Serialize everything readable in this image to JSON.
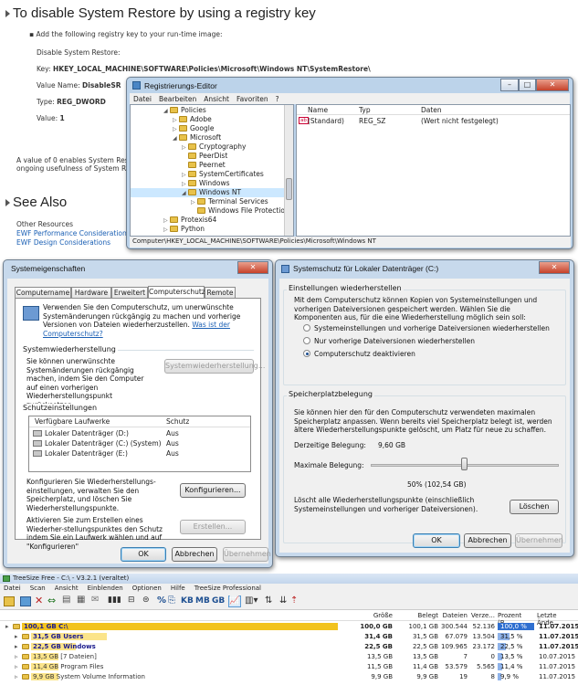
{
  "doc": {
    "heading": "To disable System Restore by using a registry key",
    "bullet": "Add the following registry key to your run-time image:",
    "disable_label": "Disable System Restore:",
    "key_label": "Key:",
    "key_value": "HKEY_LOCAL_MACHINE\\SOFTWARE\\Policies\\Microsoft\\Windows NT\\SystemRestore\\",
    "name_label": "Value Name:",
    "name_value": "DisableSR",
    "type_label": "Type:",
    "type_value": "REG_DWORD",
    "value_label": "Value:",
    "value_value": "1",
    "para1": "A value of 0 enables System Restore",
    "para2": "ongoing usefulness of System Restor",
    "see_also": "See Also",
    "other": "Other Resources",
    "link1": "EWF Performance Considerations",
    "link2": "EWF Design Considerations"
  },
  "regedit": {
    "title": "Registrierungs-Editor",
    "menu": [
      "Datei",
      "Bearbeiten",
      "Ansicht",
      "Favoriten",
      "?"
    ],
    "tree": [
      {
        "label": "Policies",
        "indent": 0,
        "exp": "◢"
      },
      {
        "label": "Adobe",
        "indent": 1,
        "exp": "▷"
      },
      {
        "label": "Google",
        "indent": 1,
        "exp": "▷"
      },
      {
        "label": "Microsoft",
        "indent": 1,
        "exp": "◢"
      },
      {
        "label": "Cryptography",
        "indent": 2,
        "exp": "▷"
      },
      {
        "label": "PeerDist",
        "indent": 2,
        "exp": ""
      },
      {
        "label": "Peernet",
        "indent": 2,
        "exp": ""
      },
      {
        "label": "SystemCertificates",
        "indent": 2,
        "exp": "▷"
      },
      {
        "label": "Windows",
        "indent": 2,
        "exp": "▷"
      },
      {
        "label": "Windows NT",
        "indent": 2,
        "exp": "◢"
      },
      {
        "label": "Terminal Services",
        "indent": 3,
        "exp": "▷"
      },
      {
        "label": "Windows File Protection",
        "indent": 3,
        "exp": ""
      },
      {
        "label": "Protexis64",
        "indent": 0,
        "exp": "▷"
      },
      {
        "label": "Python",
        "indent": 0,
        "exp": "▷"
      }
    ],
    "cols": [
      "Name",
      "Typ",
      "Daten"
    ],
    "row": {
      "name": "(Standard)",
      "type": "REG_SZ",
      "data": "(Wert nicht festgelegt)",
      "icon": "ab"
    },
    "status": "Computer\\HKEY_LOCAL_MACHINE\\SOFTWARE\\Policies\\Microsoft\\Windows NT"
  },
  "sysprops": {
    "title": "Systemeigenschaften",
    "tabs": [
      "Computername",
      "Hardware",
      "Erweitert",
      "Computerschutz",
      "Remote"
    ],
    "intro": "Verwenden Sie den Computerschutz, um unerwünschte Systemänderungen rückgängig zu machen und vorherige Versionen von Dateien wiederherzustellen.",
    "intro_link": "Was ist der Computerschutz?",
    "restore_group": "Systemwiederherstellung",
    "restore_text": "Sie können unerwünschte Systemänderungen rückgängig machen, indem Sie den Computer auf einen vorherigen Wiederherstellungspunkt zurücksetzen.",
    "restore_btn": "Systemwiederherstellung...",
    "protect_group": "Schutzeinstellungen",
    "col_drives": "Verfügbare Laufwerke",
    "col_prot": "Schutz",
    "drives": [
      {
        "name": "Lokaler Datenträger (D:)",
        "prot": "Aus"
      },
      {
        "name": "Lokaler Datenträger (C:) (System)",
        "prot": "Aus"
      },
      {
        "name": "Lokaler Datenträger (E:)",
        "prot": "Aus"
      }
    ],
    "config_text": "Konfigurieren Sie Wiederherstellungs-einstellungen, verwalten Sie den Speicherplatz, und löschen Sie Wiederherstellungspunkte.",
    "config_btn": "Konfigurieren...",
    "create_text": "Aktivieren Sie zum Erstellen eines Wiederher-stellungspunktes den Schutz indem Sie ein Laufwerk wählen und auf \"Konfigurieren\"",
    "create_btn": "Erstellen...",
    "ok": "OK",
    "cancel": "Abbrechen",
    "apply": "Übernehmen"
  },
  "sysschutz": {
    "title": "Systemschutz für Lokaler Datenträger (C:)",
    "restore_group": "Einstellungen wiederherstellen",
    "restore_text": "Mit dem Computerschutz können Kopien von Systemeinstellungen und vorherigen Dateiversionen gespeichert werden. Wählen Sie die Komponenten aus, für die eine Wiederherstellung möglich sein soll:",
    "options": [
      "Systemeinstellungen und vorherige Dateiversionen wiederherstellen",
      "Nur vorherige Dateiversionen wiederherstellen",
      "Computerschutz deaktivieren"
    ],
    "selected": 2,
    "space_group": "Speicherplatzbelegung",
    "space_text": "Sie können hier den für den Computerschutz verwendeten maximalen Speicherplatz anpassen. Wenn bereits viel Speicherplatz belegt ist, werden ältere Wiederherstellungspunkte gelöscht, um Platz für neue zu schaffen.",
    "current_label": "Derzeitige Belegung:",
    "current_value": "9,60 GB",
    "max_label": "Maximale Belegung:",
    "slider_value": "50% (102,54 GB)",
    "slider_fraction": 0.5,
    "delete_text": "Löscht alle Wiederherstellungspunkte (einschließlich Systemeinstellungen und vorheriger Dateiversionen).",
    "delete_btn": "Löschen",
    "ok": "OK",
    "cancel": "Abbrechen",
    "apply": "Übernehmen"
  },
  "treesize": {
    "title": "TreeSize Free - C:\\ - V3.2.1 (veraltet)",
    "menu": [
      "Datei",
      "Scan",
      "Ansicht",
      "Einblenden",
      "Optionen",
      "Hilfe",
      "TreeSize Professional"
    ],
    "units": [
      "KB",
      "MB",
      "GB"
    ],
    "cols": [
      "Größe",
      "Belegt",
      "Dateien",
      "Verze...",
      "Prozent (B...",
      "Letzte Ände..."
    ],
    "rows": [
      {
        "name": "100,1 GB  C:\\",
        "size": "100,0 GB",
        "alloc": "100,1 GB",
        "files": "300.544",
        "dirs": "52.136",
        "pct": "100,0 %",
        "pctnum": 100,
        "date": "11.07.2015",
        "bold": true
      },
      {
        "name": "31,5 GB  Users",
        "size": "31,4 GB",
        "alloc": "31,5 GB",
        "files": "67.079",
        "dirs": "13.504",
        "pct": "31,5 %",
        "pctnum": 31.5,
        "date": "11.07.2015",
        "bold": true
      },
      {
        "name": "22,5 GB  Windows",
        "size": "22,5 GB",
        "alloc": "22,5 GB",
        "files": "109.965",
        "dirs": "23.172",
        "pct": "22,5 %",
        "pctnum": 22.5,
        "date": "11.07.2015",
        "bold": true
      },
      {
        "name": "13,5 GB  [7 Dateien]",
        "size": "13,5 GB",
        "alloc": "13,5 GB",
        "files": "7",
        "dirs": "0",
        "pct": "13,5 %",
        "pctnum": 13.5,
        "date": "10.07.2015",
        "bold": false
      },
      {
        "name": "11,4 GB  Program Files",
        "size": "11,5 GB",
        "alloc": "11,4 GB",
        "files": "53.579",
        "dirs": "5.565",
        "pct": "11,4 %",
        "pctnum": 11.4,
        "date": "11.07.2015",
        "bold": false
      },
      {
        "name": "9,9 GB  System Volume Information",
        "size": "9,9 GB",
        "alloc": "9,9 GB",
        "files": "19",
        "dirs": "8",
        "pct": "9,9 %",
        "pctnum": 9.9,
        "date": "11.07.2015",
        "bold": false
      }
    ],
    "colors": {
      "bar": "#f2c31f",
      "bar_light": "#fbe48a"
    }
  }
}
